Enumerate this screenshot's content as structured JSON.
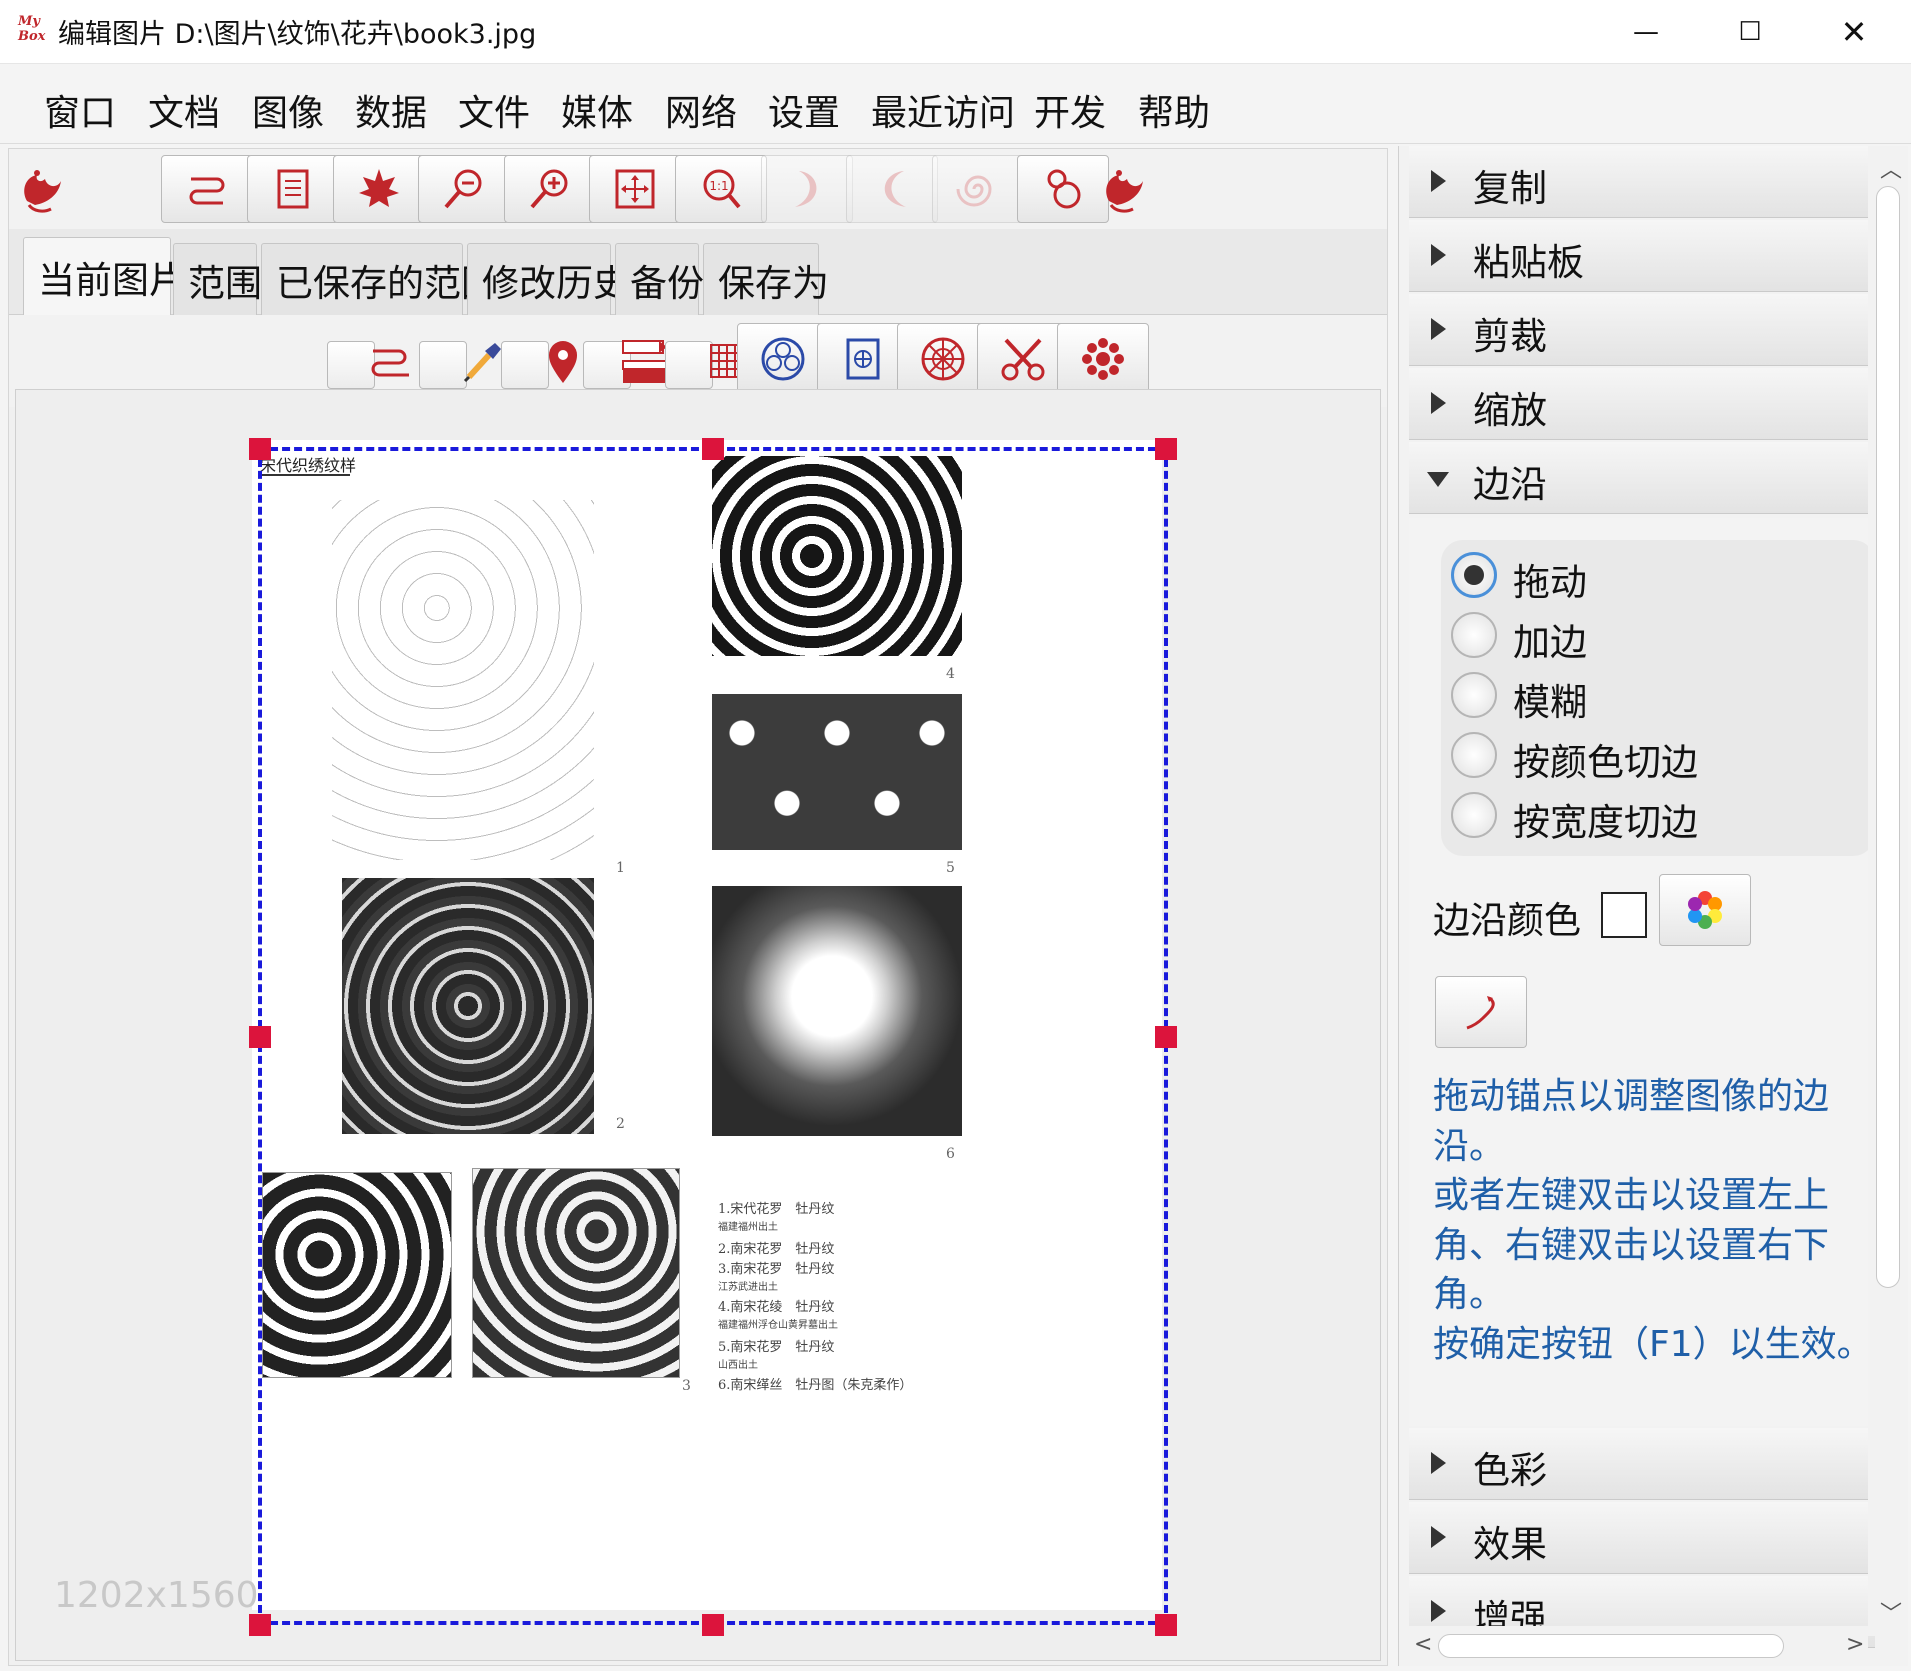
{
  "window": {
    "app_logo": "My Box",
    "title": "编辑图片 D:\\图片\\纹饰\\花卉\\book3.jpg",
    "minimize": "—",
    "maximize": "☐",
    "close": "✕"
  },
  "menu": [
    "窗口",
    "文档",
    "图像",
    "数据",
    "文件",
    "媒体",
    "网络",
    "设置",
    "最近访问",
    "开发",
    "帮助"
  ],
  "tabs": [
    "当前图片",
    "范围",
    "已保存的范围",
    "修改历史",
    "备份",
    "保存为"
  ],
  "active_tab": "当前图片",
  "image": {
    "size_label": "1202x1560",
    "header_text": "宋代织绣纹样",
    "figure_numbers": [
      "1",
      "2",
      "3",
      "4",
      "5",
      "6"
    ],
    "captions": [
      "1.宋代花罗　牡丹纹",
      "福建福州出土",
      "2.南宋花罗　牡丹纹",
      "3.南宋花罗　牡丹纹",
      "江苏武进出土",
      "4.南宋花绫　牡丹纹",
      "福建福州浮仓山黄昇墓出土",
      "5.南宋花罗　牡丹纹",
      "山西出土",
      "6.南宋缂丝　牡丹图（朱克柔作）"
    ]
  },
  "right_panel": {
    "sections_before": [
      "复制",
      "粘贴板",
      "剪裁",
      "缩放"
    ],
    "expanded_section": "边沿",
    "options": [
      "拖动",
      "加边",
      "模糊",
      "按颜色切边",
      "按宽度切边"
    ],
    "selected_option": "拖动",
    "border_color_label": "边沿颜色",
    "tip_lines": [
      "拖动锚点以调整图像的边",
      "沿。",
      "或者左键双击以设置左上",
      "角、右键双击以设置右下",
      "角。",
      "按确定按钮（F1）以生效。"
    ],
    "sections_after": [
      "色彩",
      "效果",
      "增强"
    ]
  },
  "colors": {
    "accent": "#c0262b",
    "selection": "#1a1adb",
    "handle": "#dc143c",
    "tip_text": "#1f5fa8"
  },
  "icons": {
    "toolbar": [
      "phoenix-logo-icon",
      "fold-ribbon-icon",
      "page-icon",
      "maple-leaf-icon",
      "zoom-out-icon",
      "zoom-in-icon",
      "fit-window-icon",
      "actual-size-icon",
      "rotate-left-icon",
      "rotate-right-icon",
      "spiral-icon",
      "gourd-icon",
      "phoenix-logo-icon"
    ],
    "toolbar2": [
      "ribbon-icon",
      "eyedropper-icon",
      "location-pin-icon",
      "pen-ruler-icon",
      "grid-icon",
      "blue-pattern-icon",
      "blue-square-pattern-icon",
      "red-round-pattern-icon",
      "scissors-icon",
      "red-flower-icon"
    ]
  }
}
